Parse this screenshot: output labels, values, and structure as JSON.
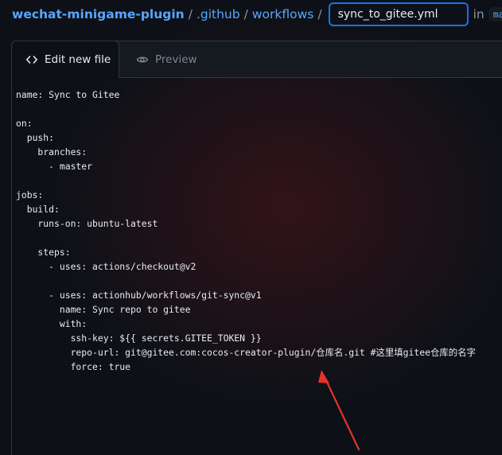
{
  "breadcrumb": {
    "repo": "wechat-minigame-plugin",
    "separator": "/",
    "folder1": ".github",
    "folder2": "workflows",
    "in_text": "in",
    "branch": "master"
  },
  "filename": {
    "value": "sync_to_gitee.yml"
  },
  "tabs": {
    "edit_label": "Edit new file",
    "preview_label": "Preview"
  },
  "code_lines": [
    "name: Sync to Gitee",
    "",
    "on:",
    "  push:",
    "    branches:",
    "      - master",
    "",
    "jobs:",
    "  build:",
    "    runs-on: ubuntu-latest",
    "",
    "    steps:",
    "      - uses: actions/checkout@v2",
    "",
    "      - uses: actionhub/workflows/git-sync@v1",
    "        name: Sync repo to gitee",
    "        with:",
    "          ssh-key: ${{ secrets.GITEE_TOKEN }}",
    "          repo-url: git@gitee.com:cocos-creator-plugin/仓库名.git #这里填gitee仓库的名字",
    "          force: true"
  ],
  "colors": {
    "link": "#58a6ff",
    "focus_border": "#1f6feb",
    "annotation_arrow": "#e5332a"
  }
}
